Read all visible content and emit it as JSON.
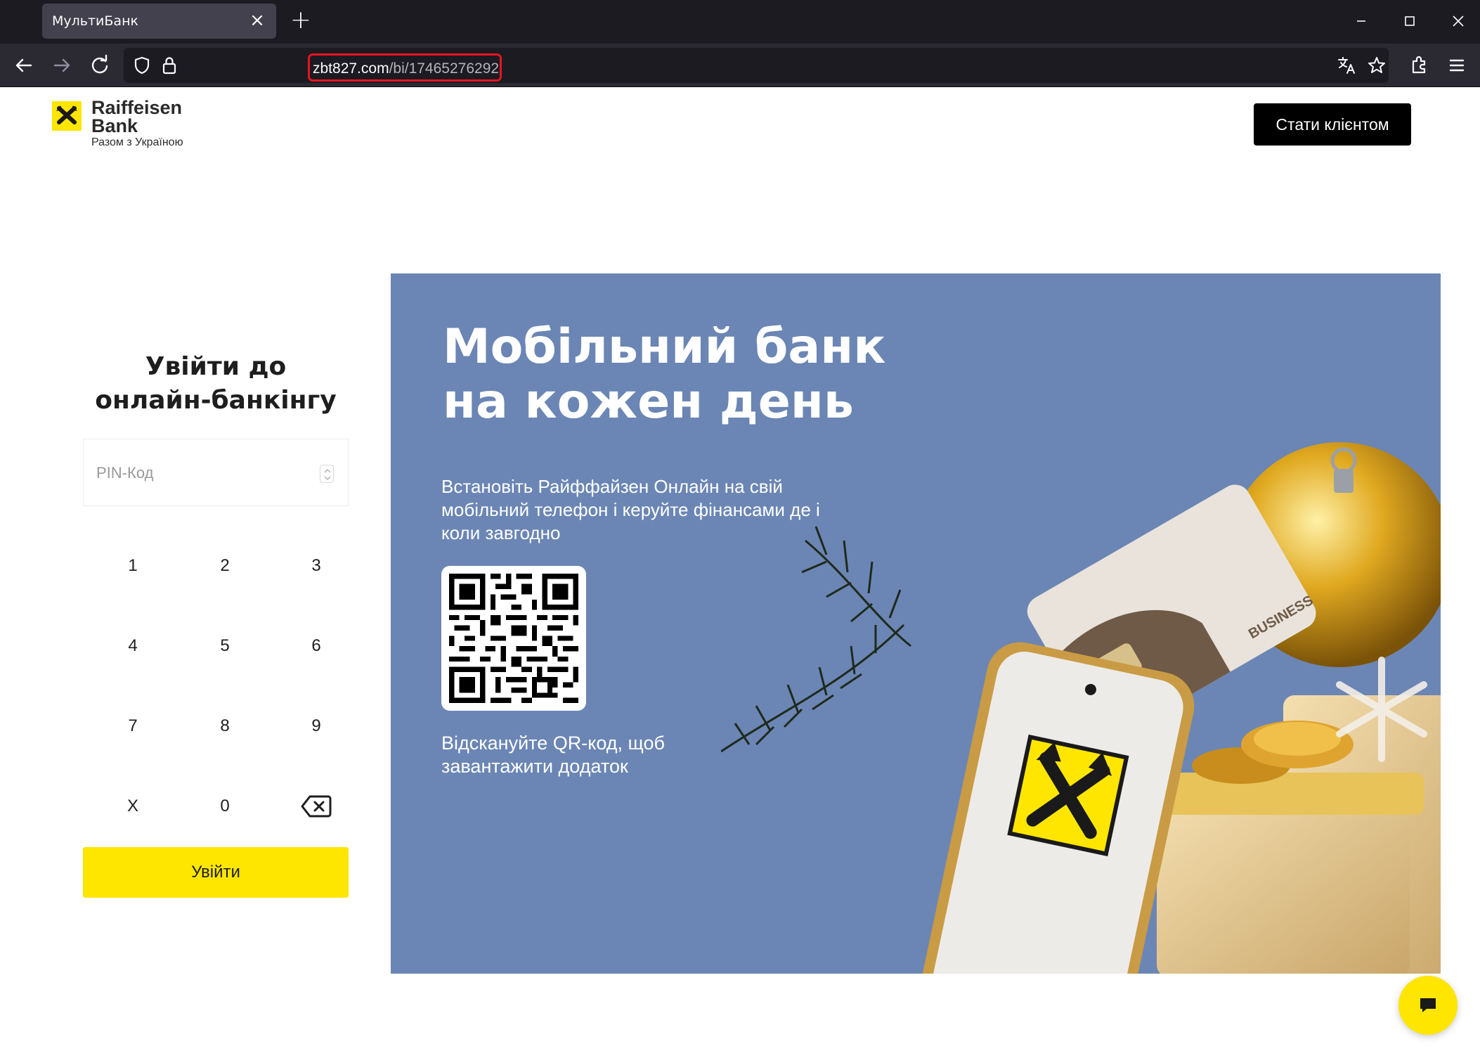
{
  "browser": {
    "tab_title": "МультиБанк",
    "url_host": "zbt827.com",
    "url_path": "/bi/17465276292"
  },
  "header": {
    "logo_line1": "Raiffeisen",
    "logo_line2": "Bank",
    "logo_tagline": "Разом з Україною",
    "become_client_label": "Стати клієнтом"
  },
  "login": {
    "title": "Увійти до онлайн-банкінгу",
    "pin_placeholder": "PIN-Код",
    "keys": [
      "1",
      "2",
      "3",
      "4",
      "5",
      "6",
      "7",
      "8",
      "9",
      "X",
      "0"
    ],
    "backspace_icon": "backspace-icon",
    "submit_label": "Увійти"
  },
  "promo": {
    "title": "Мобільний банк на кожен день",
    "description": "Встановіть Райффайзен Онлайн на свій мобільний телефон і керуйте фінансами де і коли завгодно",
    "qr_caption": "Відскануйте QR-код, щоб завантажити додаток",
    "card_label": "BUSINESS",
    "background_color": "#6b86b4"
  },
  "chat": {
    "icon": "chat-icon",
    "color": "#fee600"
  }
}
